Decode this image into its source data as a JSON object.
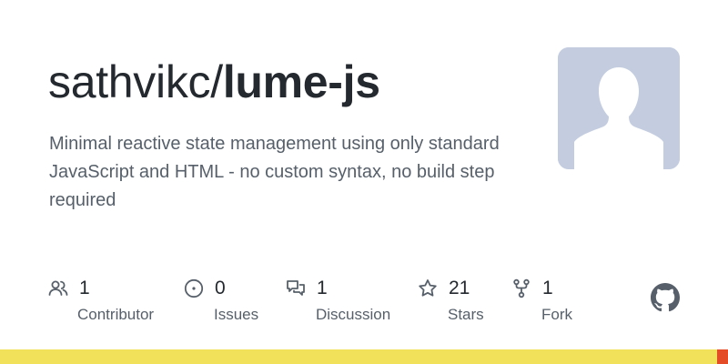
{
  "repo": {
    "owner": "sathvikc/",
    "name": "lume-js",
    "description": "Minimal reactive state management using only standard JavaScript and HTML - no custom syntax, no build step required"
  },
  "avatar": {
    "icon": "default-user-silhouette-icon",
    "color": "#c4cde0"
  },
  "stats": [
    {
      "id": "contributors",
      "value": "1",
      "label": "Contributor",
      "icon": "people-icon"
    },
    {
      "id": "issues",
      "value": "0",
      "label": "Issues",
      "icon": "issue-circle-icon"
    },
    {
      "id": "discussions",
      "value": "1",
      "label": "Discussion",
      "icon": "discussion-icon"
    },
    {
      "id": "stars",
      "value": "21",
      "label": "Stars",
      "icon": "star-icon"
    },
    {
      "id": "forks",
      "value": "1",
      "label": "Fork",
      "icon": "fork-icon"
    }
  ],
  "logo": {
    "icon": "github-logo-icon"
  },
  "language_bar": {
    "segments": [
      {
        "color": "#f1e05a",
        "share": 0.985
      },
      {
        "color": "#e34c26",
        "share": 0.015
      }
    ]
  },
  "colors": {
    "text_primary": "#24292f",
    "text_secondary": "#57606a",
    "icon": "#57606a"
  }
}
